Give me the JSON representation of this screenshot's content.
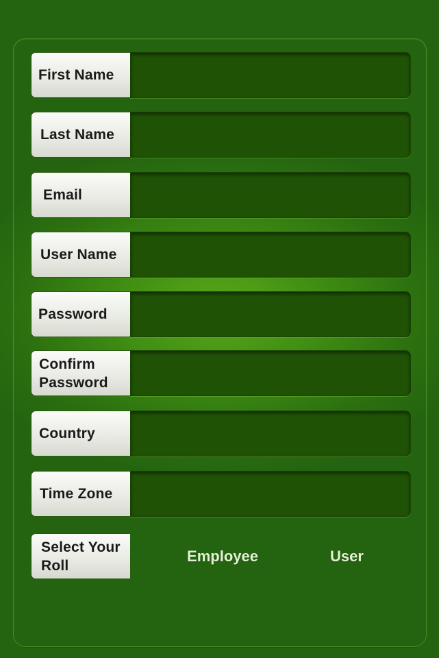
{
  "form": {
    "fields": [
      {
        "label": "First Name",
        "value": ""
      },
      {
        "label": "Last Name",
        "value": ""
      },
      {
        "label": "Email",
        "value": ""
      },
      {
        "label": "User Name",
        "value": ""
      },
      {
        "label": "Password",
        "value": ""
      },
      {
        "label": "Confirm Password",
        "value": ""
      },
      {
        "label": "Country",
        "value": ""
      },
      {
        "label": "Time Zone",
        "value": ""
      }
    ],
    "role": {
      "label": "Select Your Roll",
      "options": [
        "Employee",
        "User"
      ]
    }
  },
  "colors": {
    "background": "#3f8d13",
    "field_fill": "#1f5205",
    "label_fill": "#eceee7",
    "option_text": "#e4f0d6"
  }
}
